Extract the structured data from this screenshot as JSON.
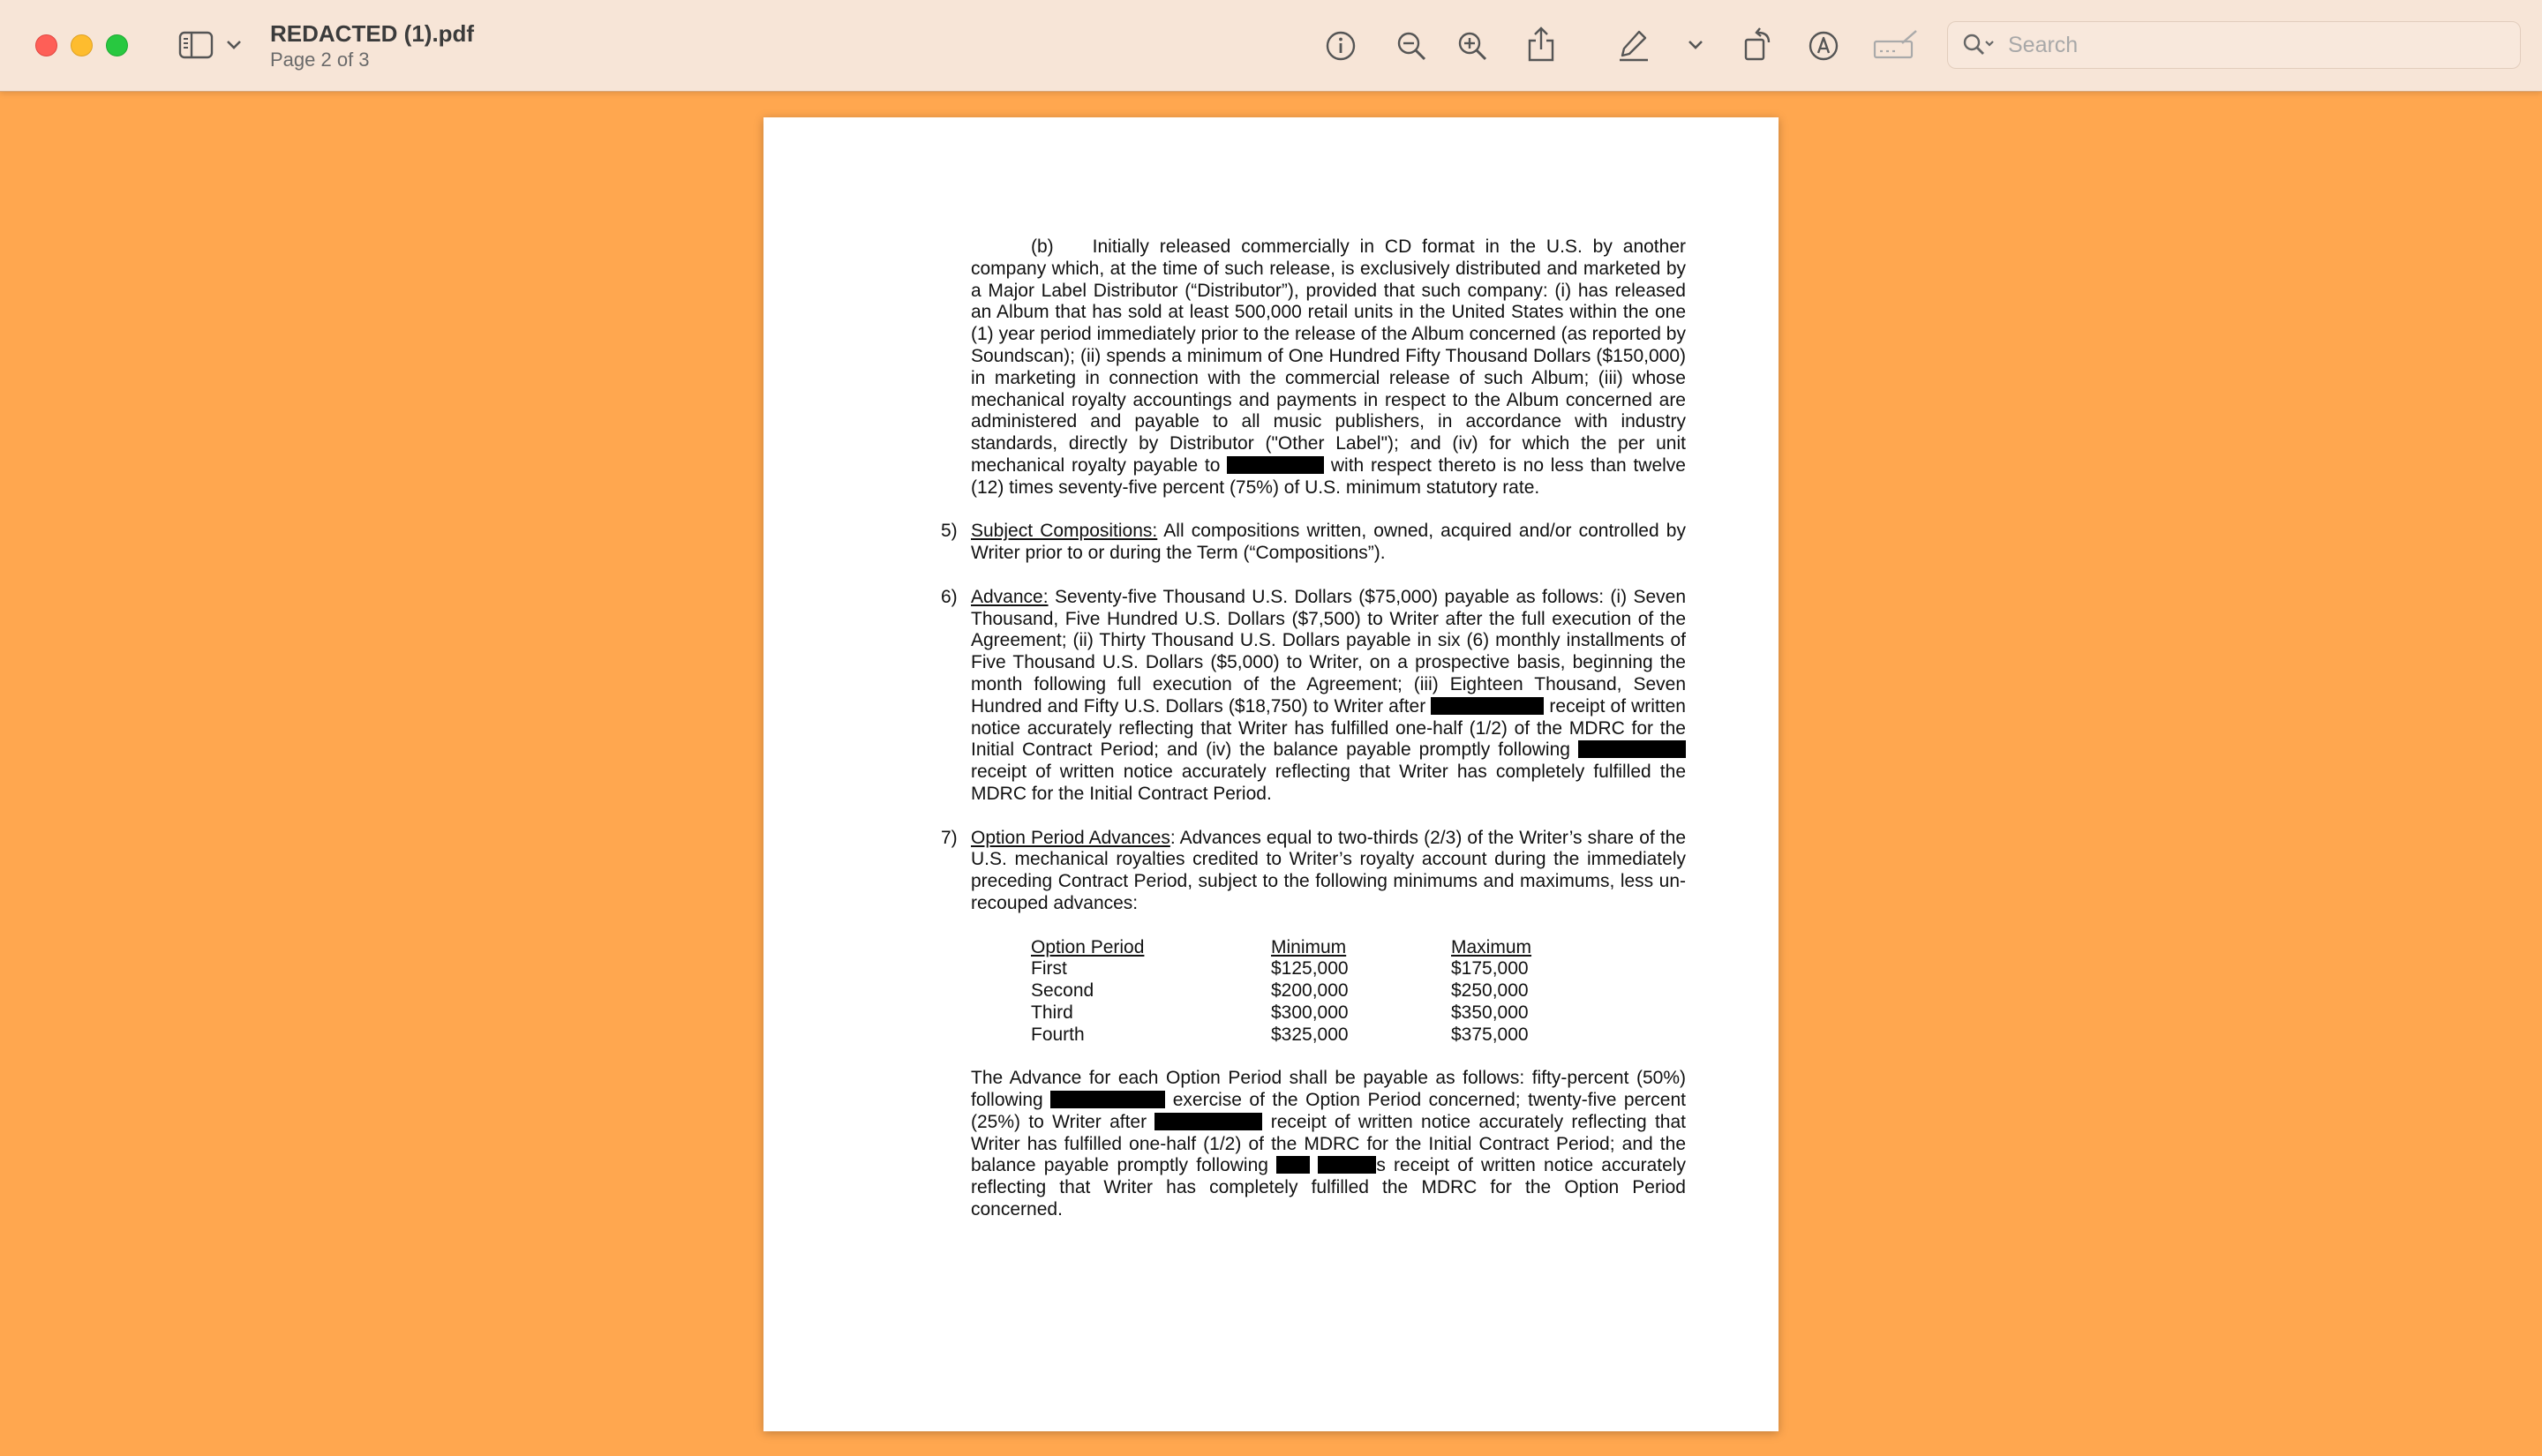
{
  "window": {
    "title": "REDACTED (1).pdf",
    "subtitle": "Page 2 of 3"
  },
  "toolbar": {
    "search_placeholder": "Search",
    "icons": [
      "sidebar-icon",
      "chevron-down-icon",
      "info-icon",
      "zoom-out-icon",
      "zoom-in-icon",
      "share-icon",
      "highlighter-icon",
      "chevron-down-icon",
      "rotate-icon",
      "markup-icon",
      "signature-icon",
      "search-icon"
    ]
  },
  "document": {
    "para_b": {
      "label": "(b)",
      "text1": "Initially released commercially in CD format in the U.S. by another company which, at the time of such release, is exclusively distributed and marketed by a Major Label Distributor (“Distributor”), provided that such company: (i) has released an Album that has sold at least 500,000 retail units in the United States within the one (1) year period immediately prior to the release of the Album concerned (as reported by Soundscan); (ii) spends a minimum of One Hundred Fifty Thousand Dollars ($150,000) in marketing in connection with the commercial release of such Album; (iii) whose mechanical royalty accountings and payments in respect to the Album concerned are administered and payable to all music publishers, in accordance with industry standards, directly by Distributor (\"Other Label\"); and (iv) for which the per unit mechanical royalty payable to",
      "text2": "with respect thereto is no less than twelve (12) times seventy-five percent (75%) of U.S. minimum statutory rate."
    },
    "sec5": {
      "num": "5)",
      "heading": "Subject Compositions:",
      "text": "All compositions written, owned, acquired and/or controlled by Writer prior to or during the Term (“Compositions”)."
    },
    "sec6": {
      "num": "6)",
      "heading": "Advance:",
      "text1": "Seventy-five Thousand U.S. Dollars ($75,000) payable as follows: (i) Seven Thousand, Five Hundred U.S. Dollars ($7,500) to Writer after the full execution of the Agreement; (ii)  Thirty Thousand U.S. Dollars payable in six (6) monthly installments of Five Thousand U.S. Dollars ($5,000) to Writer, on a prospective basis, beginning the month following full execution of the Agreement; (iii) Eighteen Thousand, Seven Hundred and Fifty U.S. Dollars ($18,750) to Writer after",
      "text2": "receipt of written notice accurately reflecting that Writer has fulfilled one-half (1/2) of the MDRC for the Initial Contract Period; and (iv) the balance payable promptly following",
      "text3": "receipt of written notice accurately reflecting that Writer has completely fulfilled the MDRC for the Initial Contract Period."
    },
    "sec7": {
      "num": "7)",
      "heading": "Option Period Advances",
      "text": ": Advances equal to two-thirds (2/3) of the Writer’s share of the U.S. mechanical royalties credited to Writer’s royalty account during the immediately preceding Contract Period, subject to the following minimums and maximums, less un-recouped advances:"
    },
    "option_table": {
      "headers": [
        "Option Period",
        "Minimum",
        "Maximum"
      ],
      "rows": [
        [
          "First",
          "$125,000",
          "$175,000"
        ],
        [
          "Second",
          "$200,000",
          "$250,000"
        ],
        [
          "Third",
          "$300,000",
          "$350,000"
        ],
        [
          "Fourth",
          "$325,000",
          "$375,000"
        ]
      ]
    },
    "closing": {
      "text1": "The Advance for each Option Period shall be payable as follows: fifty-percent (50%) following",
      "text2": "exercise of the Option Period concerned; twenty-five percent (25%) to Writer after",
      "text3": "receipt of written notice accurately reflecting that Writer has fulfilled one-half (1/2) of the MDRC for the Initial Contract Period; and the balance payable promptly following",
      "text4": "s receipt of written notice accurately reflecting that Writer has completely fulfilled the MDRC for the Option Period concerned."
    }
  }
}
